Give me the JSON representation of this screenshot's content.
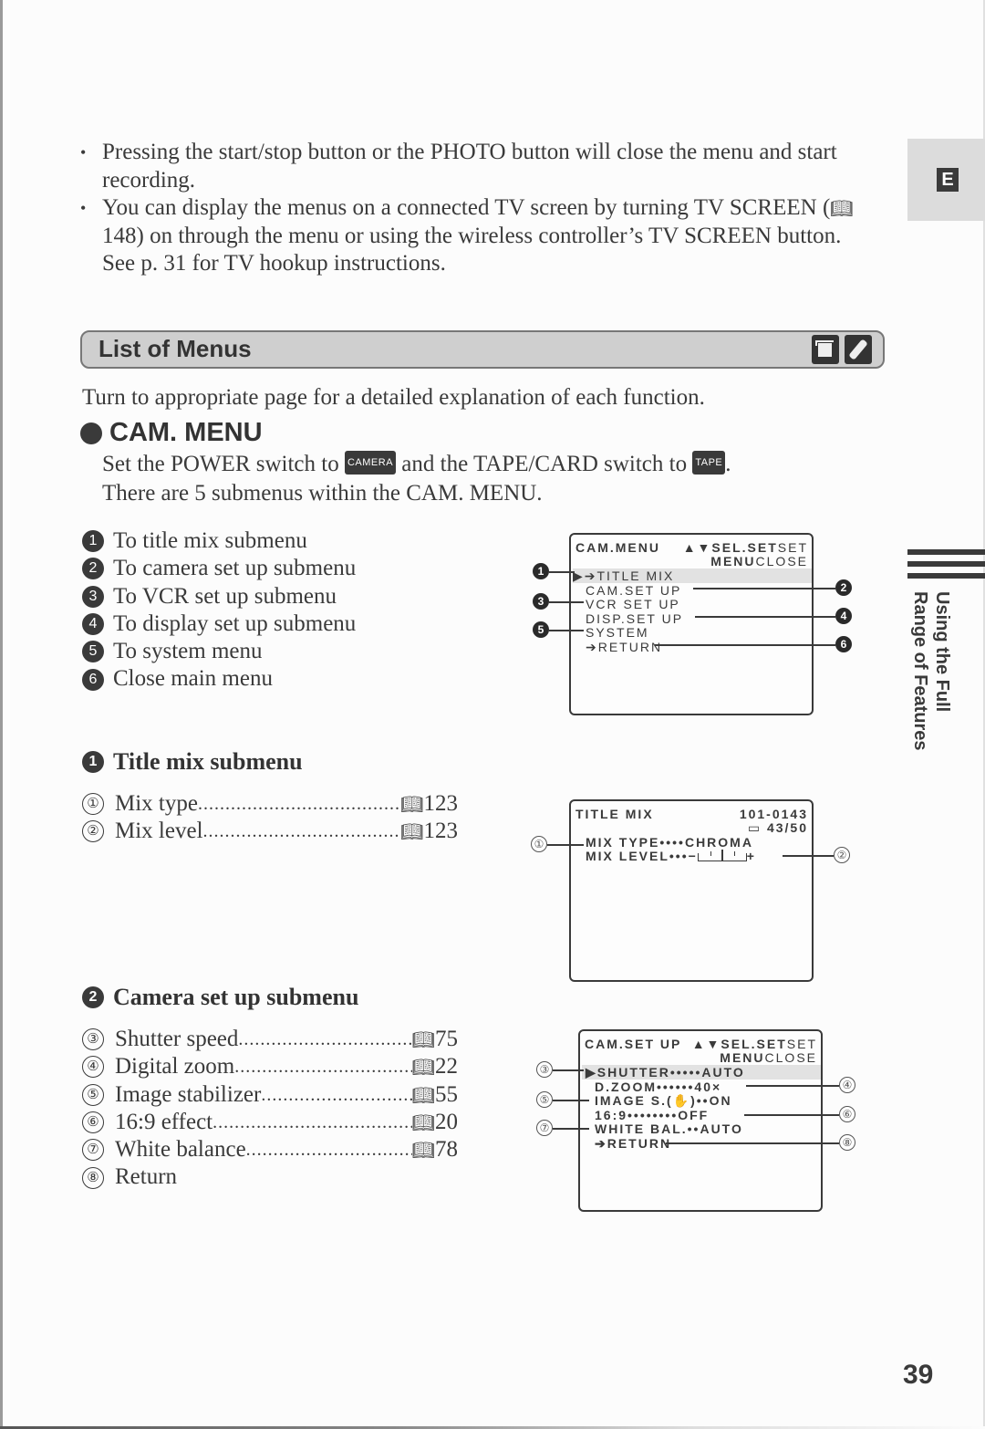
{
  "notes": [
    {
      "text": "Pressing the start/stop button or the PHOTO button will close the menu and start recording."
    },
    {
      "text_before": "You can display the menus on a connected TV screen by turning TV SCREEN (",
      "ref": "148",
      "text_after": ") on through the menu or using the wireless controller’s TV SCREEN button. See p. 31 for TV hookup instructions."
    }
  ],
  "language_tab": "E",
  "section": {
    "title": "List of Menus",
    "icons": [
      "memory-card-icon",
      "wireless-controller-icon"
    ]
  },
  "intro": "Turn to appropriate page for a detailed explanation of each function.",
  "cam_menu": {
    "heading": "CAM. MENU",
    "line1_a": "Set the POWER switch to",
    "power_badge": "CAMERA",
    "line1_b": "and the TAPE/CARD switch to",
    "tape_badge": "TAPE",
    "line1_c": ".",
    "line2": "There are 5 submenus within the CAM. MENU.",
    "items": [
      {
        "num": "1",
        "label": "To title mix submenu"
      },
      {
        "num": "2",
        "label": "To camera set up submenu"
      },
      {
        "num": "3",
        "label": "To VCR set up submenu"
      },
      {
        "num": "4",
        "label": "To display set up submenu"
      },
      {
        "num": "5",
        "label": "To system menu"
      },
      {
        "num": "6",
        "label": "Close main menu"
      }
    ],
    "screen": {
      "title": "CAM.MENU",
      "hint_keys": "▲▼SEL.SET",
      "hint_set": "SET",
      "hint_menu": "MENU",
      "hint_close": "CLOSE",
      "rows": [
        "▶➔TITLE MIX",
        "CAM.SET UP",
        "VCR SET UP",
        "DISP.SET UP",
        "SYSTEM",
        "➔RETURN"
      ],
      "callouts": [
        "1",
        "2",
        "3",
        "4",
        "5",
        "6"
      ]
    }
  },
  "title_mix": {
    "num": "1",
    "heading": "Title mix submenu",
    "items": [
      {
        "num": "①",
        "label": "Mix type",
        "ref": "123"
      },
      {
        "num": "②",
        "label": "Mix level",
        "ref": "123"
      }
    ],
    "screen": {
      "title": "TITLE MIX",
      "file_no": "101-0143",
      "count": "43/50",
      "mix_type_label": "MIX TYPE••••",
      "mix_type_value": "CHROMA",
      "mix_level_label": "MIX LEVEL•••",
      "mix_level_minus": "−",
      "mix_level_plus": "+",
      "mix_level_fraction": 0.5,
      "callouts": [
        "①",
        "②"
      ]
    }
  },
  "camera_setup": {
    "num": "2",
    "heading": "Camera set up submenu",
    "items": [
      {
        "num": "③",
        "label": "Shutter speed",
        "ref": "75"
      },
      {
        "num": "④",
        "label": "Digital zoom",
        "ref": "22"
      },
      {
        "num": "⑤",
        "label": "Image stabilizer",
        "ref": "55"
      },
      {
        "num": "⑥",
        "label": "16:9 effect",
        "ref": "20"
      },
      {
        "num": "⑦",
        "label": "White balance",
        "ref": "78"
      },
      {
        "num": "⑧",
        "label": "Return",
        "ref": ""
      }
    ],
    "screen": {
      "title": "CAM.SET UP",
      "hint_keys": "▲▼SEL.SET",
      "hint_set": "SET",
      "hint_menu": "MENU",
      "hint_close": "CLOSE",
      "rows": [
        "▶SHUTTER•••••AUTO",
        "D.ZOOM••••••40×",
        "IMAGE S.(✋)••ON",
        "16:9••••••••OFF",
        "WHITE BAL.••AUTO",
        "➔RETURN"
      ],
      "callouts": [
        "③",
        "④",
        "⑤",
        "⑥",
        "⑦",
        "⑧"
      ]
    }
  },
  "side_tab": {
    "line1": "Using the Full",
    "line2": "Range of Features"
  },
  "page_number": "39"
}
